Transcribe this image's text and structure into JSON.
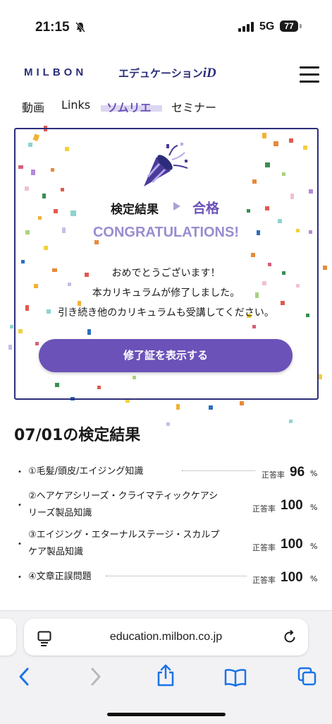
{
  "status_bar": {
    "time": "21:15",
    "network": "5G",
    "battery": "77"
  },
  "header": {
    "logo_text": "MILBON",
    "logo_sub": "エデュケーション",
    "logo_id": "iD"
  },
  "tabs": [
    {
      "label": "動画"
    },
    {
      "label": "Links"
    },
    {
      "label": "ソムリエ"
    },
    {
      "label": "セミナー"
    }
  ],
  "result_card": {
    "label": "検定結果",
    "status": "合格",
    "congrats": "CONGRATULATIONS!",
    "message": [
      "おめでとうございます！",
      "本カリキュラムが修了しました。",
      "引き続き他のカリキュラムも受講してください。"
    ],
    "button_label": "修了証を表示する"
  },
  "results": {
    "title": "07/01の検定結果",
    "rate_label": "正答率",
    "unit": "%",
    "items": [
      {
        "name": "①毛髪/頭皮/エイジング知識",
        "value": "96"
      },
      {
        "name_lines": [
          "②ヘアケアシリーズ・クライマティックケアシ",
          "リーズ製品知識"
        ],
        "value": "100"
      },
      {
        "name_lines": [
          "③エイジング・エターナルステージ・スカルプ",
          "ケア製品知識"
        ],
        "value": "100"
      },
      {
        "name": "④文章正誤問題",
        "value": "100"
      }
    ]
  },
  "browser": {
    "url": "education.milbon.co.jp"
  },
  "colors": {
    "accent": "#6b52b8",
    "navy": "#2c2d7a",
    "ios_blue": "#1a73e8"
  }
}
